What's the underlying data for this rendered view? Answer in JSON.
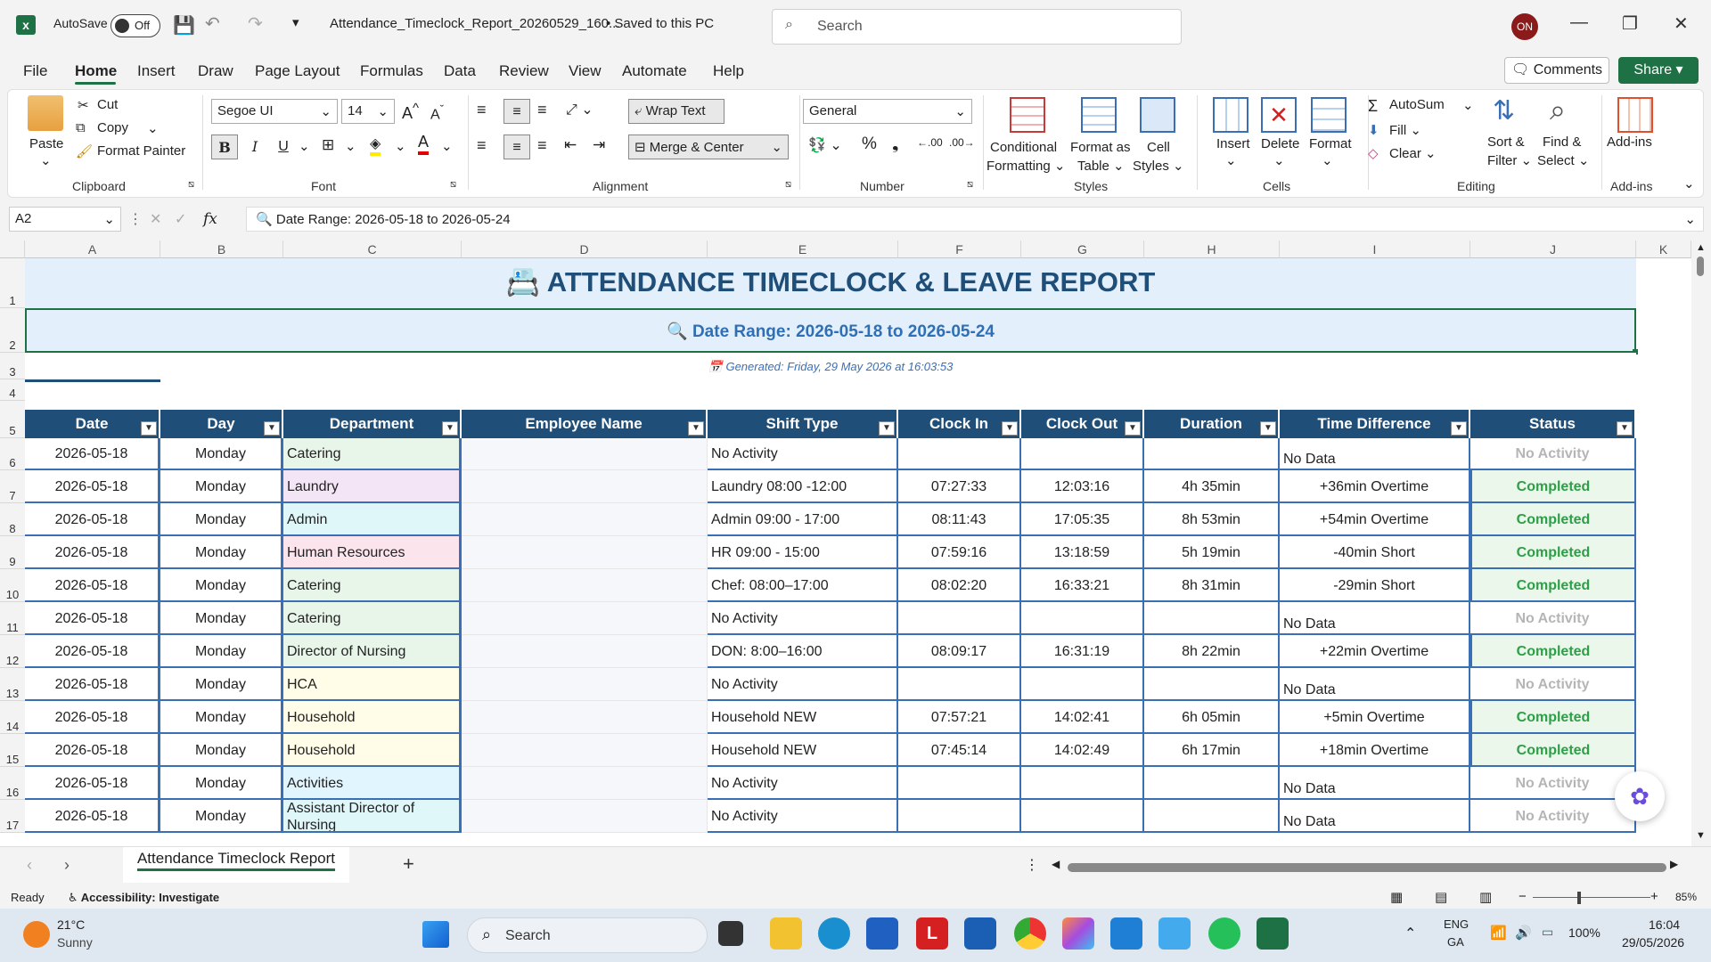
{
  "titlebar": {
    "autosave_label": "AutoSave",
    "autosave_state": "Off",
    "filename": "Attendance_Timeclock_Report_20260529_160...",
    "save_status": "• Saved to this PC",
    "search_placeholder": "Search",
    "user_initials": "ON"
  },
  "menu": [
    "File",
    "Home",
    "Insert",
    "Draw",
    "Page Layout",
    "Formulas",
    "Data",
    "Review",
    "View",
    "Automate",
    "Help"
  ],
  "actions": {
    "comments": "Comments",
    "share": "Share"
  },
  "ribbon": {
    "clipboard": {
      "paste": "Paste",
      "cut": "Cut",
      "copy": "Copy",
      "format_painter": "Format Painter",
      "label": "Clipboard"
    },
    "font": {
      "family": "Segoe UI",
      "size": "14",
      "bold": "B",
      "italic": "I",
      "underline": "U",
      "label": "Font"
    },
    "alignment": {
      "wrap": "Wrap Text",
      "merge": "Merge & Center",
      "label": "Alignment"
    },
    "number": {
      "format": "General",
      "label": "Number"
    },
    "styles": {
      "conditional": "Conditional",
      "conditional2": "Formatting",
      "format_table": "Format as",
      "format_table2": "Table",
      "cell_styles": "Cell",
      "cell_styles2": "Styles",
      "label": "Styles"
    },
    "cells": {
      "insert": "Insert",
      "delete": "Delete",
      "format": "Format",
      "label": "Cells"
    },
    "editing": {
      "autosum": "AutoSum",
      "fill": "Fill",
      "clear": "Clear",
      "sort": "Sort &",
      "sort2": "Filter",
      "find": "Find &",
      "find2": "Select",
      "label": "Editing"
    },
    "addins": {
      "label": "Add-ins",
      "btn": "Add-ins"
    }
  },
  "formula": {
    "namebox": "A2",
    "fx": "fx",
    "content": "Date Range: 2026-05-18 to 2026-05-24"
  },
  "columns": [
    "A",
    "B",
    "C",
    "D",
    "E",
    "F",
    "G",
    "H",
    "I",
    "J",
    "K"
  ],
  "report": {
    "title": "ATTENDANCE TIMECLOCK & LEAVE REPORT",
    "date_range": "Date Range: 2026-05-18 to 2026-05-24",
    "generated": "Generated: Friday, 29 May 2026 at 16:03:53"
  },
  "table_headers": [
    "Date",
    "Day",
    "Department",
    "Employee Name",
    "Shift Type",
    "Clock In",
    "Clock Out",
    "Duration",
    "Time Difference",
    "Status"
  ],
  "rows": [
    {
      "n": "6",
      "date": "2026-05-18",
      "day": "Monday",
      "dept": "Catering",
      "dept_color": "#e8f5e9",
      "shift": "No Activity",
      "in": "",
      "out": "",
      "dur": "",
      "diff": "No Data",
      "status": "No Activity"
    },
    {
      "n": "7",
      "date": "2026-05-18",
      "day": "Monday",
      "dept": "Laundry",
      "dept_color": "#f3e5f5",
      "shift": "Laundry 08:00 -12:00",
      "in": "07:27:33",
      "out": "12:03:16",
      "dur": "4h 35min",
      "diff": "+36min Overtime",
      "status": "Completed"
    },
    {
      "n": "8",
      "date": "2026-05-18",
      "day": "Monday",
      "dept": "Admin",
      "dept_color": "#e0f7fa",
      "shift": "Admin 09:00 - 17:00",
      "in": "08:11:43",
      "out": "17:05:35",
      "dur": "8h 53min",
      "diff": "+54min Overtime",
      "status": "Completed"
    },
    {
      "n": "9",
      "date": "2026-05-18",
      "day": "Monday",
      "dept": "Human Resources",
      "dept_color": "#fce4ec",
      "shift": "HR 09:00 - 15:00",
      "in": "07:59:16",
      "out": "13:18:59",
      "dur": "5h 19min",
      "diff": "-40min Short",
      "status": "Completed"
    },
    {
      "n": "10",
      "date": "2026-05-18",
      "day": "Monday",
      "dept": "Catering",
      "dept_color": "#e8f5e9",
      "shift": "Chef: 08:00–17:00",
      "in": "08:02:20",
      "out": "16:33:21",
      "dur": "8h 31min",
      "diff": "-29min Short",
      "status": "Completed"
    },
    {
      "n": "11",
      "date": "2026-05-18",
      "day": "Monday",
      "dept": "Catering",
      "dept_color": "#e8f5e9",
      "shift": "No Activity",
      "in": "",
      "out": "",
      "dur": "",
      "diff": "No Data",
      "status": "No Activity"
    },
    {
      "n": "12",
      "date": "2026-05-18",
      "day": "Monday",
      "dept": "Director of Nursing",
      "dept_color": "#e8f5e9",
      "shift": "DON: 8:00–16:00",
      "in": "08:09:17",
      "out": "16:31:19",
      "dur": "8h 22min",
      "diff": "+22min Overtime",
      "status": "Completed"
    },
    {
      "n": "13",
      "date": "2026-05-18",
      "day": "Monday",
      "dept": "HCA",
      "dept_color": "#fffde7",
      "shift": "No Activity",
      "in": "",
      "out": "",
      "dur": "",
      "diff": "No Data",
      "status": "No Activity"
    },
    {
      "n": "14",
      "date": "2026-05-18",
      "day": "Monday",
      "dept": "Household",
      "dept_color": "#fffde7",
      "shift": "Household NEW",
      "in": "07:57:21",
      "out": "14:02:41",
      "dur": "6h 05min",
      "diff": "+5min Overtime",
      "status": "Completed"
    },
    {
      "n": "15",
      "date": "2026-05-18",
      "day": "Monday",
      "dept": "Household",
      "dept_color": "#fffde7",
      "shift": "Household NEW",
      "in": "07:45:14",
      "out": "14:02:49",
      "dur": "6h 17min",
      "diff": "+18min Overtime",
      "status": "Completed"
    },
    {
      "n": "16",
      "date": "2026-05-18",
      "day": "Monday",
      "dept": "Activities",
      "dept_color": "#e1f5fe",
      "shift": "No Activity",
      "in": "",
      "out": "",
      "dur": "",
      "diff": "No Data",
      "status": "No Activity"
    },
    {
      "n": "17",
      "date": "2026-05-18",
      "day": "Monday",
      "dept": "Assistant Director of Nursing",
      "dept_color": "#e0f7fa",
      "shift": "No Activity",
      "in": "",
      "out": "",
      "dur": "",
      "diff": "No Data",
      "status": "No Activity"
    }
  ],
  "sheet_tab": "Attendance Timeclock Report",
  "status": {
    "ready": "Ready",
    "accessibility": "Accessibility: Investigate",
    "zoom": "85%"
  },
  "taskbar": {
    "temp": "21°C",
    "weather": "Sunny",
    "search": "Search",
    "lang1": "ENG",
    "lang2": "GA",
    "battery": "100%",
    "time": "16:04",
    "date": "29/05/2026"
  },
  "colors": {
    "header_bg": "#1f4e79",
    "completed": "#2e9e48",
    "no_activity": "#b5b5b5",
    "accent": "#1e7145",
    "title_text": "#1f4e79",
    "range_text": "#2f6fb5"
  }
}
